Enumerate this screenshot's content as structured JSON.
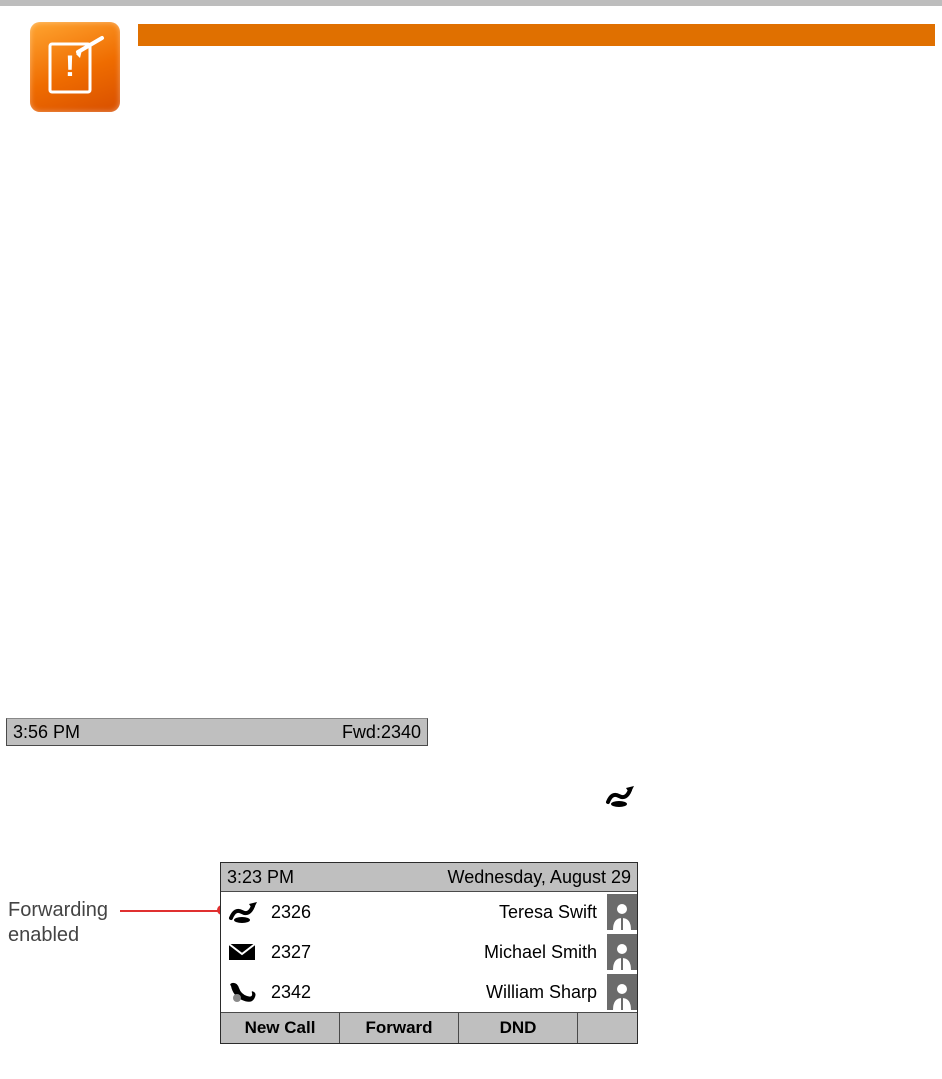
{
  "phone_bar_1": {
    "time": "3:56 PM",
    "forward_status": "Fwd:2340"
  },
  "annotation": {
    "line1": "Forwarding",
    "line2": "enabled"
  },
  "phone_screen_2": {
    "status": {
      "time": "3:23 PM",
      "date": "Wednesday, August 29"
    },
    "lines": [
      {
        "icon": "forward-enabled-icon",
        "extension": "2326",
        "name": "Teresa Swift"
      },
      {
        "icon": "voicemail-icon",
        "extension": "2327",
        "name": "Michael Smith"
      },
      {
        "icon": "missed-call-icon",
        "extension": "2342",
        "name": "William Sharp"
      }
    ],
    "softkeys": {
      "k1": "New Call",
      "k2": "Forward",
      "k3": "DND"
    }
  }
}
